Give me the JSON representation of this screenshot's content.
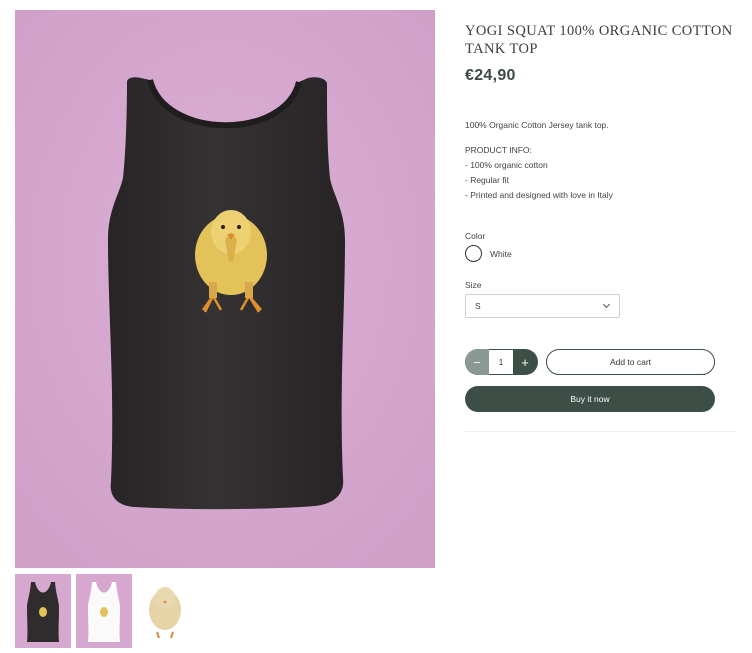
{
  "product": {
    "title": "YOGI SQUAT 100% ORGANIC COTTON TANK TOP",
    "price": "€24,90",
    "description": "100% Organic Cotton Jersey tank top.",
    "info_heading": "PRODUCT INFO:",
    "info_lines": [
      "- 100% organic cotton",
      "- Regular fit",
      "- Printed and designed with love in Italy"
    ]
  },
  "options": {
    "color_label": "Color",
    "color_value": "White",
    "size_label": "Size",
    "size_value": "S"
  },
  "purchase": {
    "qty_minus": "−",
    "qty_value": "1",
    "qty_plus": "+",
    "add_to_cart": "Add to cart",
    "buy_now": "Buy it now"
  },
  "colors": {
    "background_pink": "#d6a8d0",
    "tank_black": "#2e2c2d",
    "brand_dark": "#3c4e46",
    "chick_yellow": "#e8c860"
  },
  "thumbnails": [
    {
      "icon": "black-tank-thumbnail"
    },
    {
      "icon": "white-tank-thumbnail"
    },
    {
      "icon": "chick-thumbnail"
    }
  ]
}
